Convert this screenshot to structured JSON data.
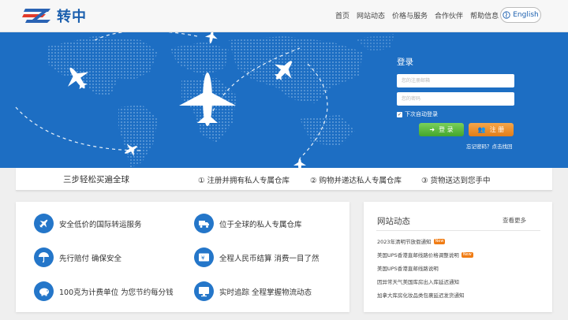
{
  "header": {
    "logo_text": "转中",
    "nav": [
      "首页",
      "网站动态",
      "价格与服务",
      "合作伙伴",
      "帮助信息"
    ],
    "lang_label": "English"
  },
  "login": {
    "title": "登录",
    "email_placeholder": "您的注册邮箱",
    "password_placeholder": "您的密码",
    "remember_label": "下次自动登录",
    "login_button": "登 录",
    "register_button": "注 册",
    "forgot_text": "忘记密码？点击找回"
  },
  "steps": {
    "title": "三步轻松买遍全球",
    "items": [
      "① 注册并拥有私人专属仓库",
      "② 购物并递达私人专属仓库",
      "③ 货物送达到您手中"
    ]
  },
  "features": [
    {
      "icon": "airplane-icon",
      "text": "安全低价的国际转运服务"
    },
    {
      "icon": "truck-icon",
      "text": "位于全球的私人专属仓库"
    },
    {
      "icon": "umbrella-icon",
      "text": "先行赔付 确保安全"
    },
    {
      "icon": "currency-card-icon",
      "text": "全程人民币结算 消费一目了然"
    },
    {
      "icon": "piggy-bank-icon",
      "text": "100克为计费单位 为您节约每分钱"
    },
    {
      "icon": "monitor-icon",
      "text": "实时追踪 全程掌握物流动态"
    }
  ],
  "news": {
    "title": "网站动态",
    "more": "查看更多",
    "badge": "New",
    "items": [
      {
        "text": "2023年清明节放假通知",
        "is_new": true
      },
      {
        "text": "美国UPS香港直邮线路价格调整说明",
        "is_new": true
      },
      {
        "text": "美国UPS香港直邮线路说明",
        "is_new": false
      },
      {
        "text": "因异常天气美国库房出入库延迟通知",
        "is_new": false
      },
      {
        "text": "加拿大库房化妆品类包裹延迟发货通知",
        "is_new": false
      }
    ]
  },
  "colors": {
    "brand_blue": "#1b5fae",
    "banner_blue": "#1d6ec3",
    "login_green": "#4fb034",
    "register_orange": "#ee8f2a",
    "badge_orange": "#f07c14"
  }
}
